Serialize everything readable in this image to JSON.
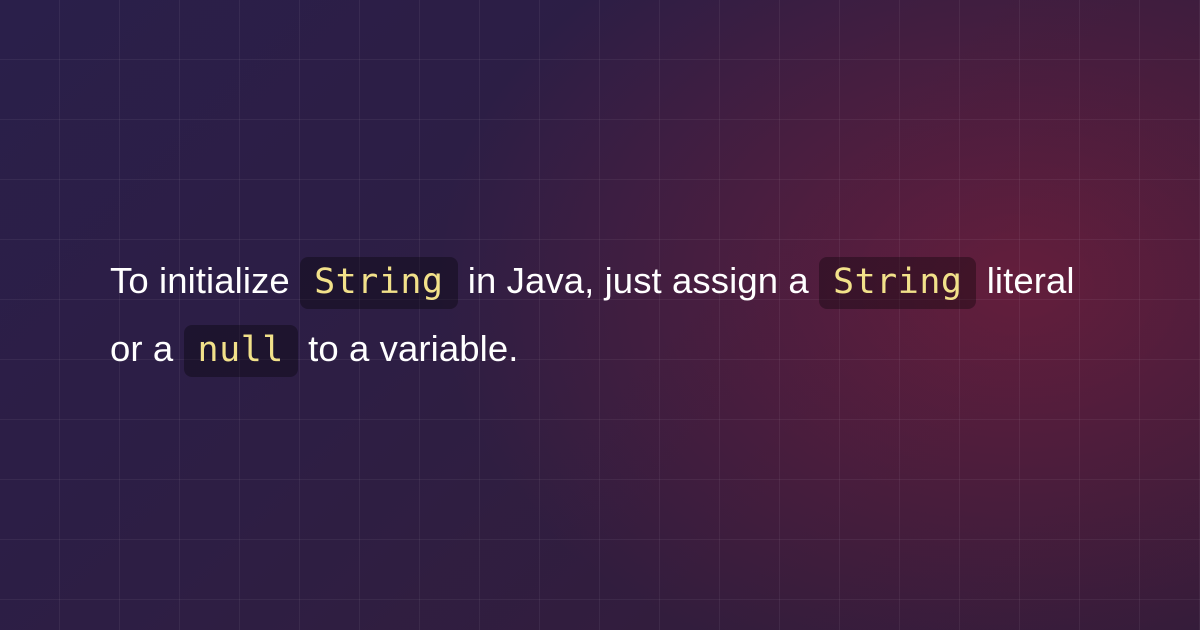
{
  "sentence": {
    "part1": "To initialize ",
    "code1": "String",
    "part2": " in Java, just assign a ",
    "code2": "String",
    "part3": " literal or a ",
    "code3": "null",
    "part4": " to a variable."
  }
}
